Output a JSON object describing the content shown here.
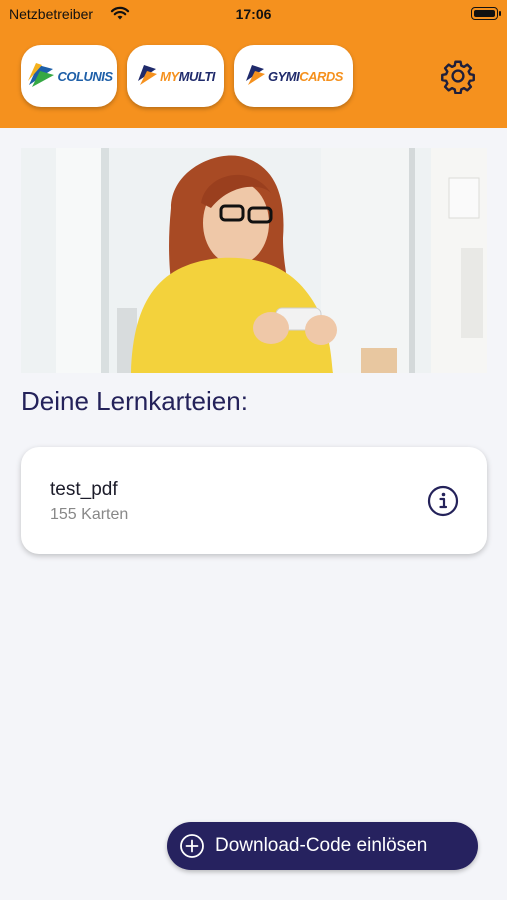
{
  "status_bar": {
    "carrier": "Netzbetreiber",
    "time": "17:06"
  },
  "header": {
    "apps": [
      {
        "name": "COLUNIS",
        "brand_color": "#1e5fa8",
        "accent": "#36a844"
      },
      {
        "name": "MYMULTI",
        "prefix": "MY",
        "suffix": "MULTI",
        "brand_color": "#1f2a6b",
        "accent": "#f5911e"
      },
      {
        "name": "GYMICARDS",
        "prefix": "GYMI",
        "suffix": "CARDS",
        "brand_color": "#1f2a6b",
        "accent": "#f5911e"
      }
    ],
    "settings_icon": "gear-icon",
    "bar_color": "#f5911e"
  },
  "main": {
    "section_title": "Deine Lernkarteien:",
    "decks": [
      {
        "title": "test_pdf",
        "subtitle": "155 Karten",
        "icon": "info-icon"
      }
    ]
  },
  "fab": {
    "label": "Download-Code einlösen",
    "icon": "plus-circle-icon",
    "color": "#26225f"
  }
}
